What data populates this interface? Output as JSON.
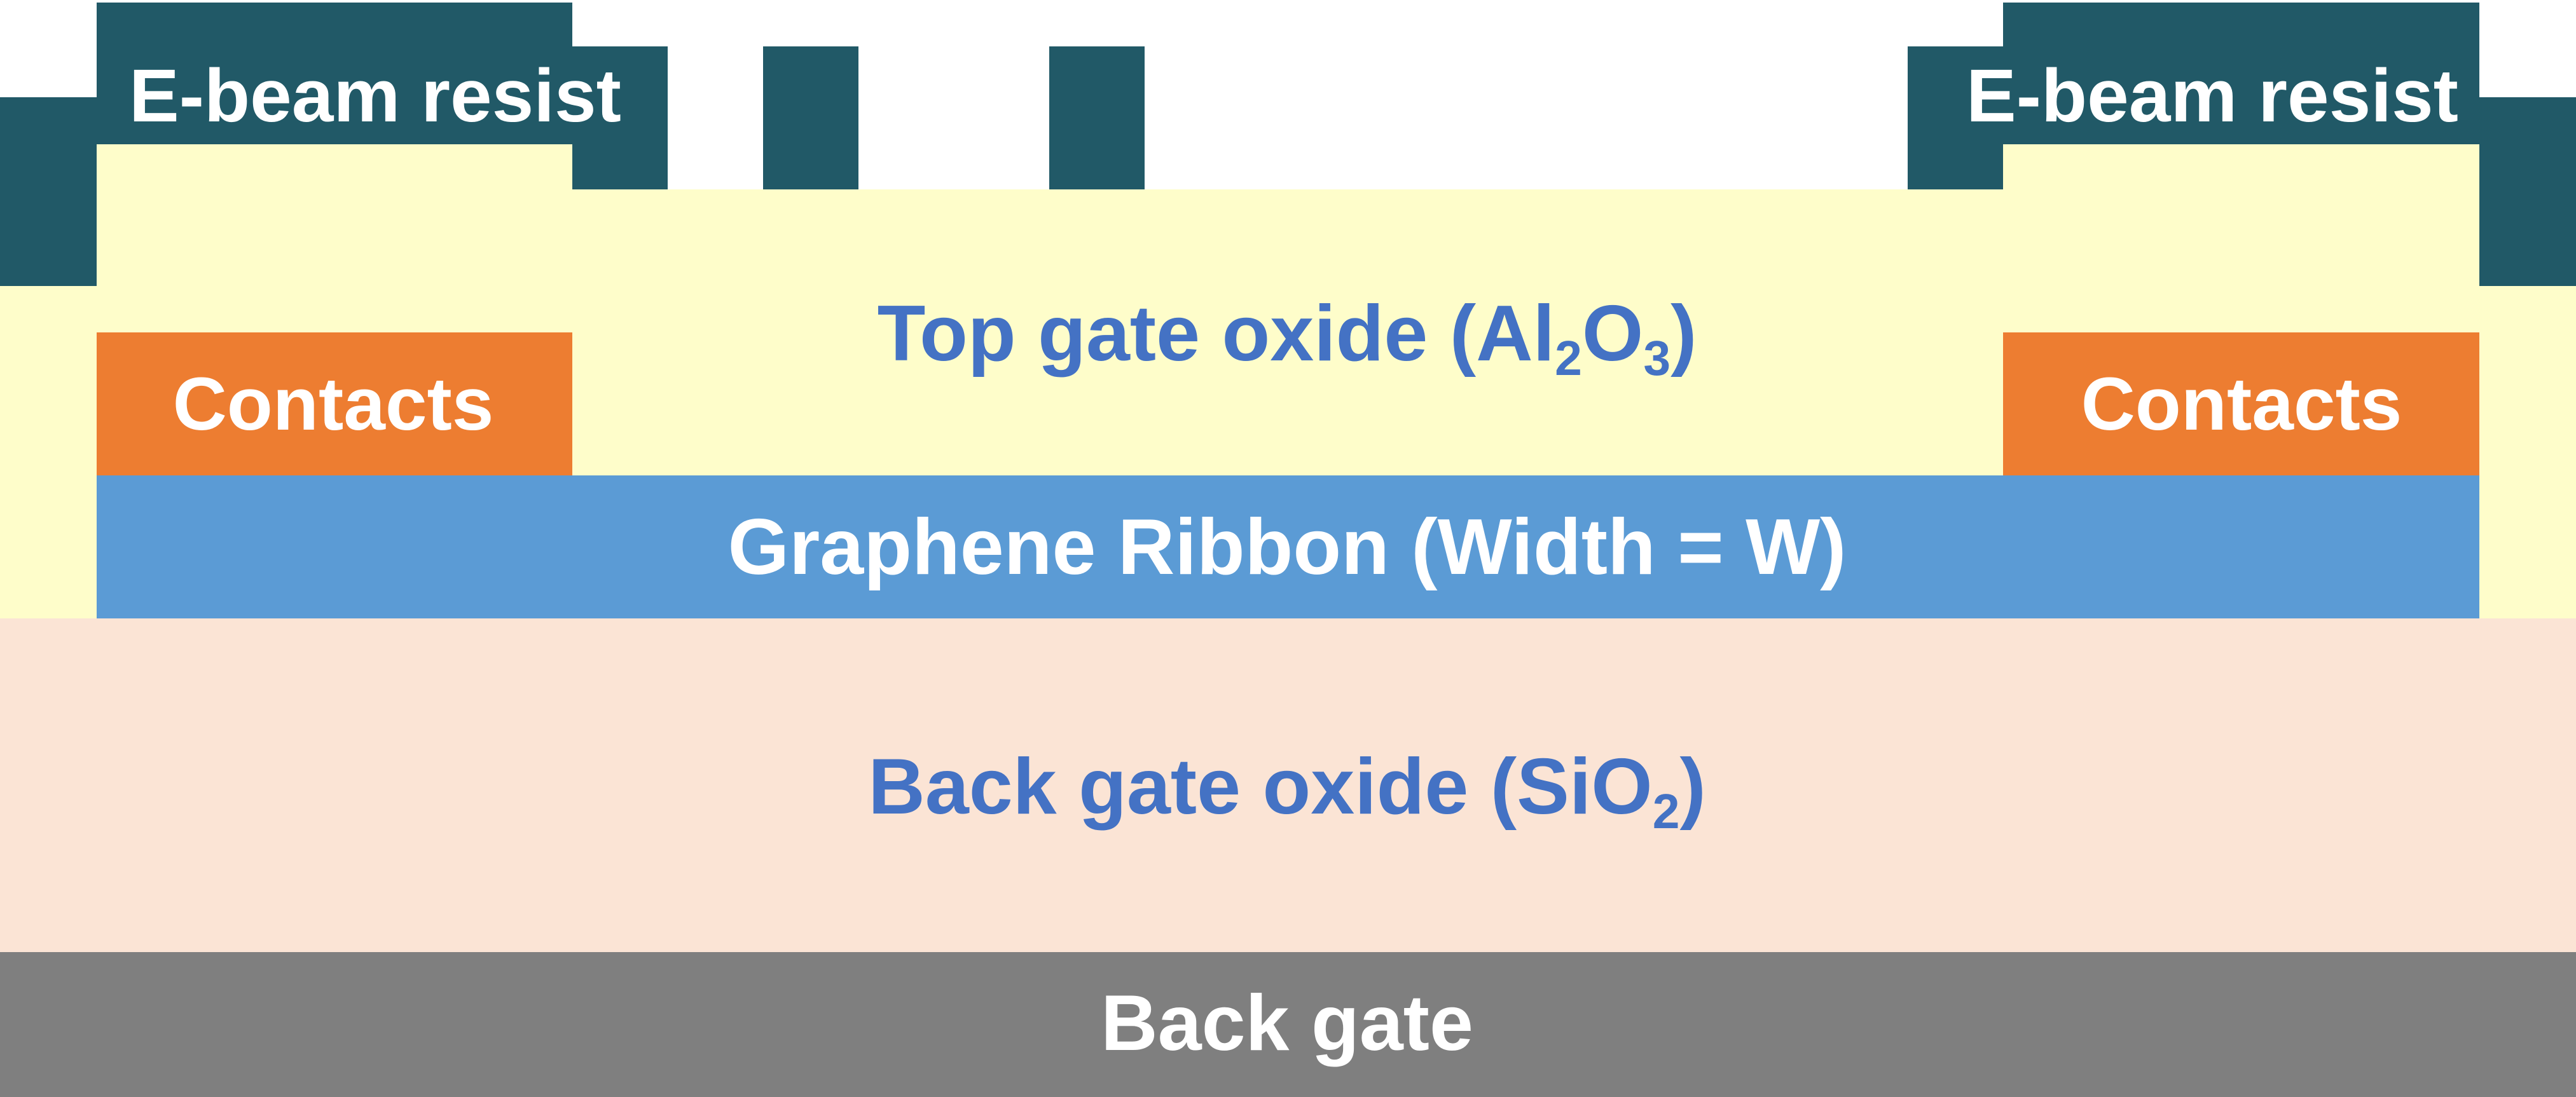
{
  "diagram": {
    "colors": {
      "resist": "#215967",
      "top_oxide": "#fefdca",
      "contacts": "#ed7d31",
      "graphene": "#5b9bd5",
      "back_oxide": "#fbe4d5",
      "back_gate": "#7f7f7f",
      "opening": "#ffffff",
      "light_text": "#ffffff",
      "oxide_text": "#4472c4"
    },
    "labels": {
      "resist_left": "E-beam resist",
      "resist_right": "E-beam resist",
      "top_oxide_prefix": "Top gate oxide (Al",
      "top_oxide_sub1": "2",
      "top_oxide_mid": "O",
      "top_oxide_sub2": "3",
      "top_oxide_suffix": ")",
      "contacts_left": "Contacts",
      "contacts_right": "Contacts",
      "graphene": "Graphene Ribbon (Width = W)",
      "back_oxide_prefix": "Back gate oxide (SiO",
      "back_oxide_sub": "2",
      "back_oxide_suffix": ")",
      "back_gate": "Back gate"
    }
  }
}
